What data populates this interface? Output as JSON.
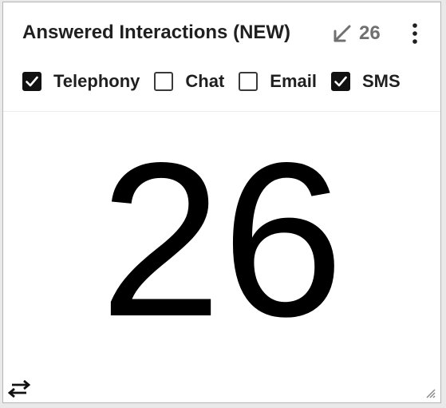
{
  "widget": {
    "title": "Answered Interactions (NEW)",
    "trend_icon": "arrow-down-left-icon",
    "trend_value": "26",
    "menu_icon": "kebab-menu-icon",
    "filters": [
      {
        "label": "Telephony",
        "checked": true
      },
      {
        "label": "Chat",
        "checked": false
      },
      {
        "label": "Email",
        "checked": false
      },
      {
        "label": "SMS",
        "checked": true
      }
    ],
    "value": "26",
    "swap_icon": "swap-arrows-icon",
    "resize_icon": "resize-handle-icon"
  },
  "colors": {
    "title": "#1f1f1f",
    "trend": "#707070",
    "checkbox_checked": "#111111",
    "value": "#000000"
  }
}
